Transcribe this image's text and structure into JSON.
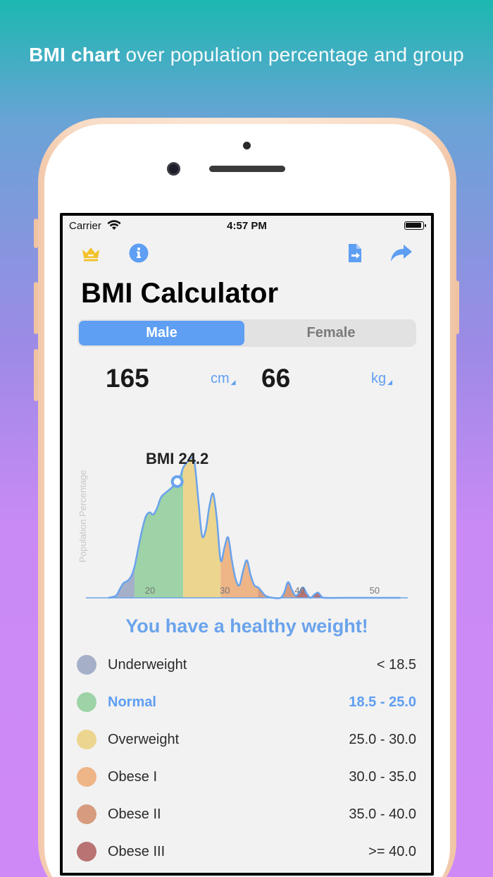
{
  "promo": {
    "bold": "BMI chart",
    "light": "over population percentage and group"
  },
  "status_bar": {
    "carrier": "Carrier",
    "time": "4:57 PM"
  },
  "toolbar": {
    "icons": [
      "crown-icon",
      "info-icon",
      "export-document-icon",
      "share-icon"
    ],
    "accent_color": "#5e9ef3",
    "crown_color": "#f2c22c"
  },
  "title": "BMI Calculator",
  "gender": {
    "options": [
      "Male",
      "Female"
    ],
    "selected": "Male"
  },
  "height": {
    "value": "165",
    "unit": "cm"
  },
  "weight": {
    "value": "66",
    "unit": "kg"
  },
  "chart_data": {
    "type": "area",
    "ylabel": "Population Percentage",
    "xlabel": "",
    "xlim": [
      12,
      55
    ],
    "x_ticks": [
      "20",
      "30",
      "40",
      "50"
    ],
    "marker": {
      "label": "BMI 24.2",
      "x": 24.2
    },
    "series": [
      {
        "x": [
          15,
          16,
          16.5,
          17,
          17.5,
          18,
          18.5,
          19,
          19.5,
          20,
          20.5,
          21,
          21.5,
          22,
          22.5,
          23,
          23.5,
          24,
          24.5,
          25,
          25.5,
          26,
          26.5,
          27,
          27.5,
          28,
          28.5,
          29,
          29.5,
          30,
          30.5,
          31,
          31.5,
          32,
          32.5,
          33,
          33.5,
          34,
          34.5,
          35,
          35.5,
          36,
          37,
          38,
          38.5,
          39,
          39.5,
          40,
          40.5,
          41,
          41.5,
          42,
          42.5,
          43,
          43.5,
          44,
          46,
          50,
          54
        ],
        "values": [
          0,
          2,
          8,
          14,
          16,
          20,
          30,
          48,
          65,
          78,
          82,
          80,
          86,
          96,
          100,
          103,
          106,
          110,
          114,
          125,
          130,
          134,
          130,
          95,
          60,
          65,
          88,
          100,
          75,
          36,
          48,
          58,
          36,
          18,
          12,
          26,
          36,
          22,
          12,
          10,
          6,
          2,
          0,
          0,
          5,
          15,
          8,
          2,
          5,
          10,
          4,
          0,
          3,
          5,
          1,
          0,
          0,
          0,
          0
        ]
      }
    ],
    "bands": [
      {
        "name": "Underweight",
        "from": 12,
        "to": 18.5,
        "color": "#a5b0c8"
      },
      {
        "name": "Normal",
        "from": 18.5,
        "to": 25,
        "color": "#9dd3a6"
      },
      {
        "name": "Overweight",
        "from": 25,
        "to": 30,
        "color": "#ecd58e"
      },
      {
        "name": "Obese I",
        "from": 30,
        "to": 35,
        "color": "#eeb587"
      },
      {
        "name": "Obese II",
        "from": 35,
        "to": 40,
        "color": "#d79c7f"
      },
      {
        "name": "Obese III",
        "from": 40,
        "to": 55,
        "color": "#b87372"
      }
    ],
    "line_color": "#6aa3ec"
  },
  "verdict": "You have a healthy weight!",
  "categories": [
    {
      "name": "Underweight",
      "range": "< 18.5",
      "color": "#a5b0c8",
      "current": false
    },
    {
      "name": "Normal",
      "range": "18.5 - 25.0",
      "color": "#9dd3a6",
      "current": true
    },
    {
      "name": "Overweight",
      "range": "25.0 - 30.0",
      "color": "#ecd58e",
      "current": false
    },
    {
      "name": "Obese I",
      "range": "30.0 - 35.0",
      "color": "#eeb587",
      "current": false
    },
    {
      "name": "Obese II",
      "range": "35.0 - 40.0",
      "color": "#d79c7f",
      "current": false
    },
    {
      "name": "Obese III",
      "range": ">= 40.0",
      "color": "#b87372",
      "current": false
    }
  ]
}
